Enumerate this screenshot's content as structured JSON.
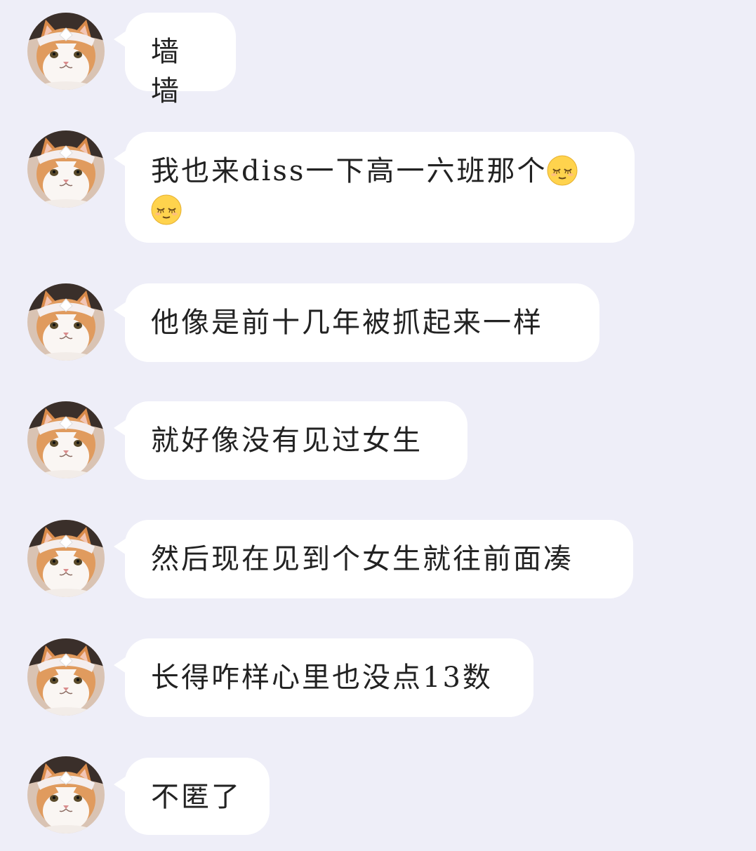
{
  "colors": {
    "background": "#eeeef8",
    "bubble": "#ffffff",
    "text": "#222222",
    "emoji": "#ffd34d"
  },
  "messages": [
    {
      "text": "墙墙"
    },
    {
      "text": "我也来diss一下高一六班那个",
      "emoji_icon": "relieved-face-emoji"
    },
    {
      "text": "他像是前十几年被抓起来一样"
    },
    {
      "text": "就好像没有见过女生"
    },
    {
      "text": "然后现在见到个女生就往前面凑"
    },
    {
      "text": "长得咋样心里也没点13数"
    },
    {
      "text": "不匿了"
    }
  ]
}
